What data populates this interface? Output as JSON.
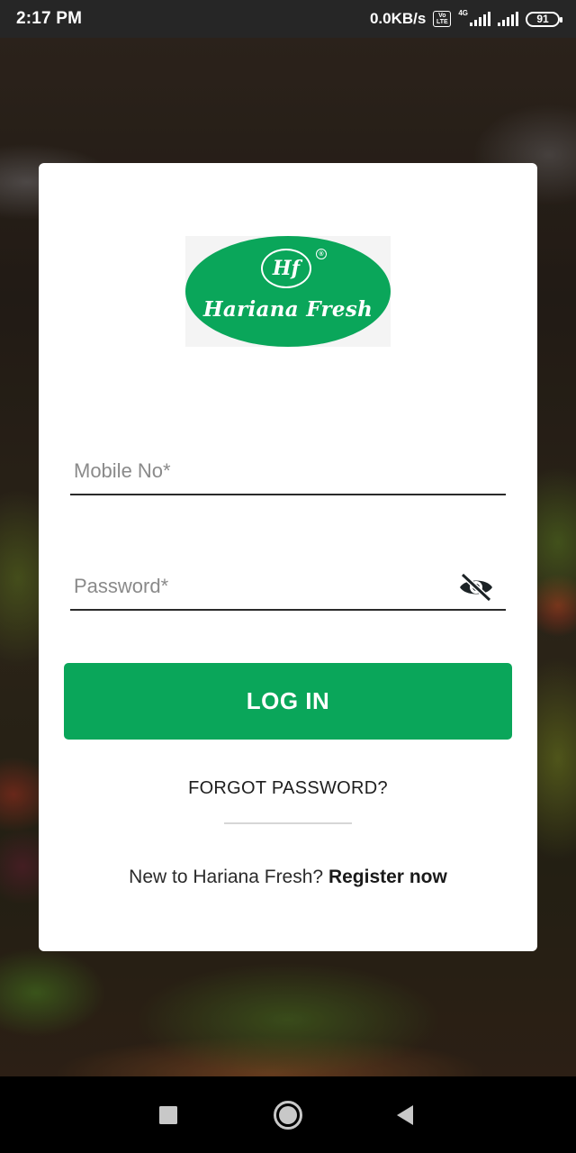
{
  "status_bar": {
    "time": "2:17 PM",
    "net_speed": "0.0KB/s",
    "volte_top": "Vo",
    "volte_bottom": "LTE",
    "network_type": "4G",
    "battery": "91"
  },
  "logo": {
    "monogram": "Hf",
    "reg_mark": "®",
    "brand": "Hariana Fresh",
    "color": "#0aa65a"
  },
  "form": {
    "mobile_placeholder": "Mobile No*",
    "mobile_value": "",
    "password_placeholder": "Password*",
    "password_value": "",
    "password_visibility_icon": "eye-off-icon",
    "login_label": "LOG IN",
    "forgot_label": "FORGOT PASSWORD?",
    "register_prompt": "New to Hariana Fresh?",
    "register_link": "Register now"
  },
  "nav_bar": {
    "recent_icon": "square-recents-icon",
    "home_icon": "circle-home-icon",
    "back_icon": "triangle-back-icon"
  },
  "colors": {
    "accent": "#0aa65a",
    "status_bar": "#262626",
    "nav_bar": "#000000",
    "card": "#ffffff"
  }
}
